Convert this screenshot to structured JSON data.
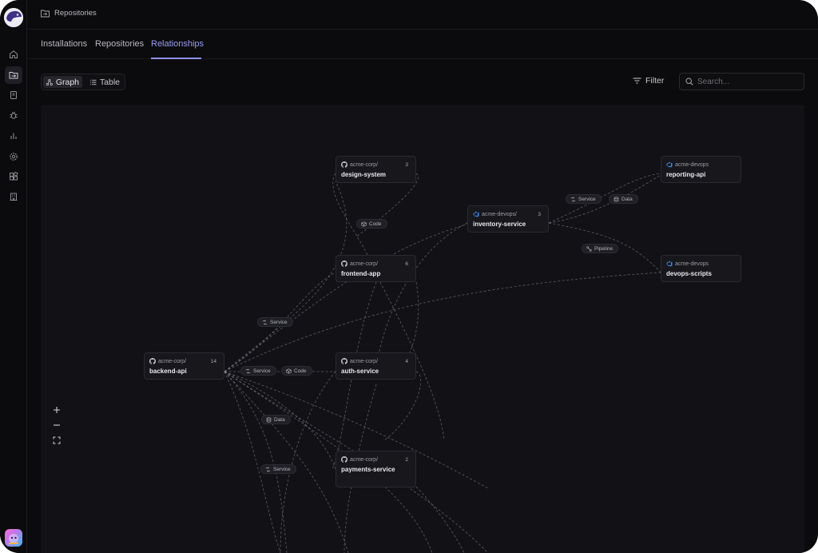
{
  "breadcrumb": {
    "icon": "folder-icon",
    "label": "Repositories"
  },
  "tabs": [
    {
      "label": "Installations",
      "active": false
    },
    {
      "label": "Repositories",
      "active": false
    },
    {
      "label": "Relationships",
      "active": true
    }
  ],
  "view_toggle": {
    "graph_label": "Graph",
    "table_label": "Table",
    "selected": "Graph"
  },
  "filter": {
    "label": "Filter"
  },
  "search": {
    "placeholder": "Search..."
  },
  "sidebar": {
    "items": [
      {
        "icon": "home-icon",
        "active": false
      },
      {
        "icon": "repositories-folder-icon",
        "active": true
      },
      {
        "icon": "book-icon",
        "active": false
      },
      {
        "icon": "bug-icon",
        "active": false
      },
      {
        "icon": "bar-chart-icon",
        "active": false
      },
      {
        "icon": "gear-icon",
        "active": false
      },
      {
        "icon": "integrations-icon",
        "active": false
      },
      {
        "icon": "building-icon",
        "active": false
      }
    ]
  },
  "graph": {
    "nodes": [
      {
        "id": "design-system",
        "owner": "acme-corp/",
        "provider": "github",
        "name": "design-system",
        "count": "3"
      },
      {
        "id": "inventory-service",
        "owner": "acme-devops/",
        "provider": "azure",
        "name": "inventory-service",
        "count": "3"
      },
      {
        "id": "reporting-api",
        "owner": "acme-devops",
        "provider": "azure",
        "name": "reporting-api",
        "count": ""
      },
      {
        "id": "frontend-app",
        "owner": "acme-corp/",
        "provider": "github",
        "name": "frontend-app",
        "count": "6"
      },
      {
        "id": "devops-scripts",
        "owner": "acme-devops",
        "provider": "azure",
        "name": "devops-scripts",
        "count": ""
      },
      {
        "id": "backend-api",
        "owner": "acme-corp/",
        "provider": "github",
        "name": "backend-api",
        "count": "14"
      },
      {
        "id": "auth-service",
        "owner": "acme-corp/",
        "provider": "github",
        "name": "auth-service",
        "count": "4"
      },
      {
        "id": "payments-service",
        "owner": "acme-corp/",
        "provider": "github",
        "name": "payments-service",
        "count": "2"
      }
    ],
    "edge_labels": [
      {
        "label": "Code",
        "icon": "package-icon"
      },
      {
        "label": "Service",
        "icon": "service-icon"
      },
      {
        "label": "Data",
        "icon": "database-icon"
      },
      {
        "label": "Pipeline",
        "icon": "pipeline-icon"
      },
      {
        "label": "Service",
        "icon": "service-icon"
      },
      {
        "label": "Service",
        "icon": "service-icon"
      },
      {
        "label": "Code",
        "icon": "package-icon"
      },
      {
        "label": "Data",
        "icon": "database-icon"
      },
      {
        "label": "Service",
        "icon": "service-icon"
      }
    ]
  },
  "zoom_controls": [
    {
      "icon": "zoom-in-icon"
    },
    {
      "icon": "zoom-out-icon"
    },
    {
      "icon": "fit-view-icon"
    }
  ],
  "colors": {
    "background": "#0b0b0d",
    "canvas": "#111116",
    "accent": "#9a9cf3",
    "node": "#17171c",
    "azure": "#3d8bf0"
  }
}
